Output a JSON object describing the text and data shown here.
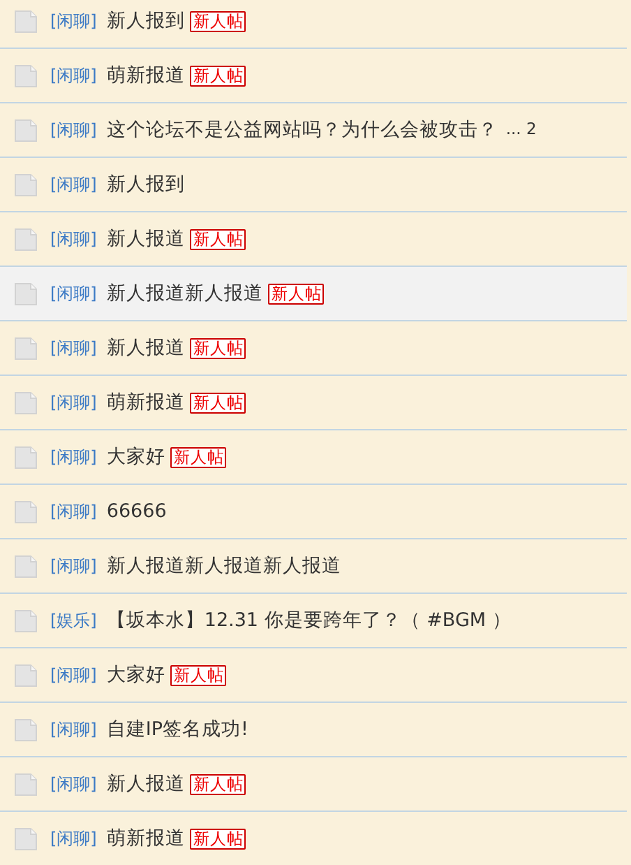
{
  "threads": [
    {
      "category": "[闲聊]",
      "title": "新人报到",
      "badge": "新人帖",
      "highlighted": false
    },
    {
      "category": "[闲聊]",
      "title": "萌新报道",
      "badge": "新人帖",
      "highlighted": false
    },
    {
      "category": "[闲聊]",
      "title": "这个论坛不是公益网站吗？为什么会被攻击？",
      "pages": "... 2",
      "highlighted": false
    },
    {
      "category": "[闲聊]",
      "title": "新人报到",
      "highlighted": false
    },
    {
      "category": "[闲聊]",
      "title": "新人报道",
      "badge": "新人帖",
      "highlighted": false
    },
    {
      "category": "[闲聊]",
      "title": "新人报道新人报道",
      "badge": "新人帖",
      "highlighted": true
    },
    {
      "category": "[闲聊]",
      "title": "新人报道",
      "badge": "新人帖",
      "highlighted": false
    },
    {
      "category": "[闲聊]",
      "title": "萌新报道",
      "badge": "新人帖",
      "highlighted": false
    },
    {
      "category": "[闲聊]",
      "title": "大家好",
      "badge": "新人帖",
      "highlighted": false
    },
    {
      "category": "[闲聊]",
      "title": "66666",
      "highlighted": false
    },
    {
      "category": "[闲聊]",
      "title": "新人报道新人报道新人报道",
      "highlighted": false
    },
    {
      "category": "[娱乐]",
      "title": "【坂本水】12.31 你是要跨年了？（ #BGM ）",
      "highlighted": false
    },
    {
      "category": "[闲聊]",
      "title": "大家好",
      "badge": "新人帖",
      "highlighted": false
    },
    {
      "category": "[闲聊]",
      "title": "自建IP签名成功!",
      "highlighted": false
    },
    {
      "category": "[闲聊]",
      "title": "新人报道",
      "badge": "新人帖",
      "highlighted": false
    },
    {
      "category": "[闲聊]",
      "title": "萌新报道",
      "badge": "新人帖",
      "highlighted": false
    }
  ]
}
